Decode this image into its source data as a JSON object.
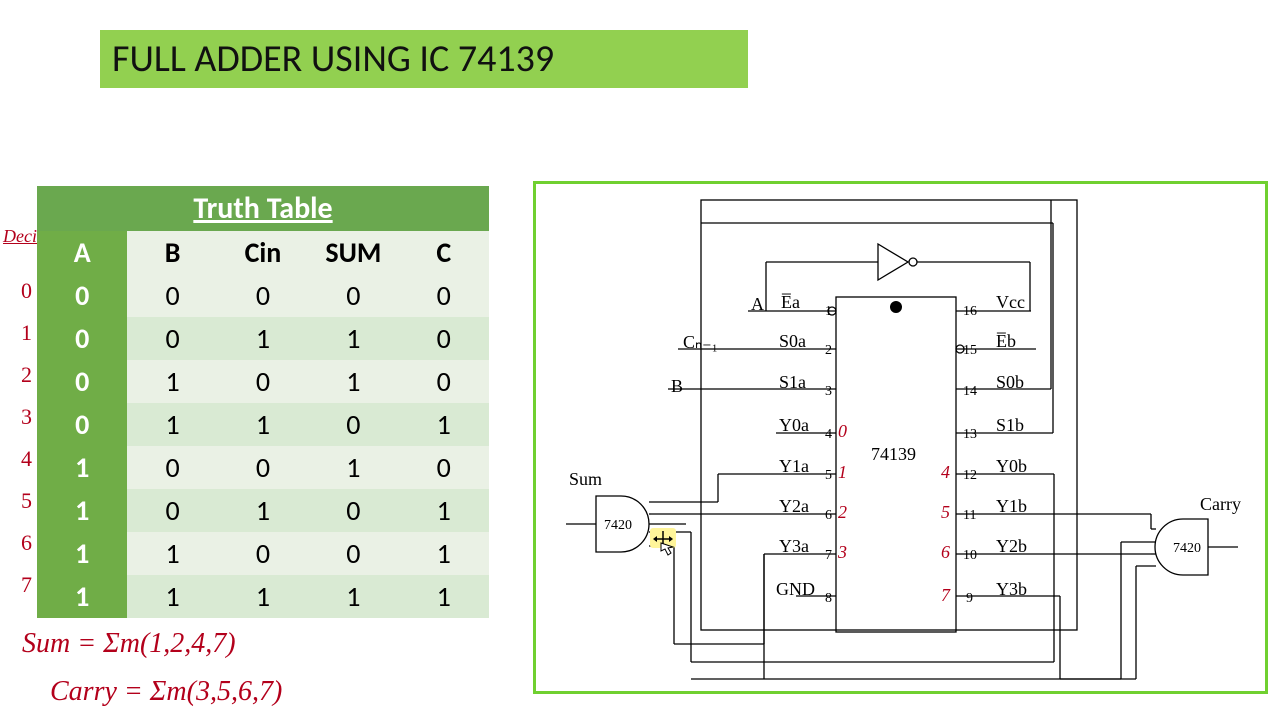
{
  "title": "FULL ADDER USING IC 74139",
  "truth_table": {
    "caption": "Truth Table",
    "headers": [
      "A",
      "B",
      "Cin",
      "SUM",
      "C"
    ],
    "rows": [
      [
        "0",
        "0",
        "0",
        "0",
        "0"
      ],
      [
        "0",
        "0",
        "1",
        "1",
        "0"
      ],
      [
        "0",
        "1",
        "0",
        "1",
        "0"
      ],
      [
        "0",
        "1",
        "1",
        "0",
        "1"
      ],
      [
        "1",
        "0",
        "0",
        "1",
        "0"
      ],
      [
        "1",
        "0",
        "1",
        "0",
        "1"
      ],
      [
        "1",
        "1",
        "0",
        "0",
        "1"
      ],
      [
        "1",
        "1",
        "1",
        "1",
        "1"
      ]
    ],
    "decimal_label": "Decimal",
    "decimal_indices": [
      "0",
      "1",
      "2",
      "3",
      "4",
      "5",
      "6",
      "7"
    ]
  },
  "equations": {
    "sum": "Sum = Σm(1,2,4,7)",
    "carry": "Carry = Σm(3,5,6,7)"
  },
  "circuit": {
    "ic_label": "74139",
    "left_gate": "7420",
    "right_gate": "7420",
    "sum_label": "Sum",
    "carry_label": "Carry",
    "input_A": "A",
    "input_B": "B",
    "input_Cin": "Cₙ₋₁",
    "left_pins": [
      {
        "name": "E̅a",
        "num": "1",
        "red": ""
      },
      {
        "name": "S0a",
        "num": "2",
        "red": ""
      },
      {
        "name": "S1a",
        "num": "3",
        "red": ""
      },
      {
        "name": "Y0a",
        "num": "4",
        "red": "0"
      },
      {
        "name": "Y1a",
        "num": "5",
        "red": "1"
      },
      {
        "name": "Y2a",
        "num": "6",
        "red": "2"
      },
      {
        "name": "Y3a",
        "num": "7",
        "red": "3"
      },
      {
        "name": "GND",
        "num": "8",
        "red": ""
      }
    ],
    "right_pins": [
      {
        "name": "Vcc",
        "num": "16",
        "red": ""
      },
      {
        "name": "E̅b",
        "num": "15",
        "red": ""
      },
      {
        "name": "S0b",
        "num": "14",
        "red": ""
      },
      {
        "name": "S1b",
        "num": "13",
        "red": ""
      },
      {
        "name": "Y0b",
        "num": "12",
        "red": "4"
      },
      {
        "name": "Y1b",
        "num": "11",
        "red": "5"
      },
      {
        "name": "Y2b",
        "num": "10",
        "red": "6"
      },
      {
        "name": "Y3b",
        "num": "9",
        "red": "7"
      }
    ]
  }
}
